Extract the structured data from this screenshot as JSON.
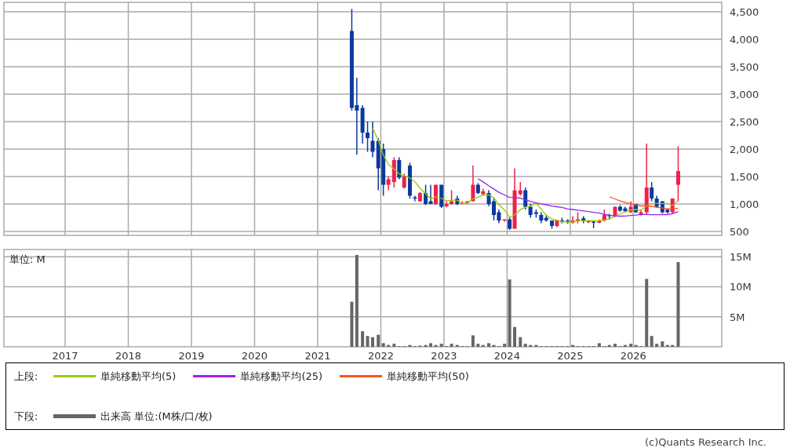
{
  "price_chart": {
    "chart_data": {
      "type": "candlestick",
      "grid": true,
      "xlim": [
        2016.03,
        2027.4
      ],
      "ylim": [
        429,
        4671
      ],
      "yticks": [
        {
          "value": 500,
          "label": "500"
        },
        {
          "value": 1000,
          "label": "1,000"
        },
        {
          "value": 1500,
          "label": "1,500"
        },
        {
          "value": 2000,
          "label": "2,000"
        },
        {
          "value": 2500,
          "label": "2,500"
        },
        {
          "value": 3000,
          "label": "3,000"
        },
        {
          "value": 3500,
          "label": "3,500"
        },
        {
          "value": 4000,
          "label": "4,000"
        },
        {
          "value": 4500,
          "label": "4,500"
        }
      ],
      "x": [
        2021.54,
        2021.62,
        2021.71,
        2021.79,
        2021.87,
        2021.96,
        2022.04,
        2022.12,
        2022.21,
        2022.29,
        2022.37,
        2022.46,
        2022.54,
        2022.62,
        2022.71,
        2022.79,
        2022.87,
        2022.96,
        2023.04,
        2023.12,
        2023.21,
        2023.29,
        2023.37,
        2023.46,
        2023.54,
        2023.62,
        2023.71,
        2023.79,
        2023.87,
        2023.96,
        2024.04,
        2024.12,
        2024.21,
        2024.29,
        2024.37,
        2024.46,
        2024.54,
        2024.62,
        2024.71,
        2024.79,
        2024.87,
        2024.96,
        2025.04,
        2025.12,
        2025.21,
        2025.29,
        2025.37,
        2025.46,
        2025.54,
        2025.62,
        2025.71,
        2025.79,
        2025.87,
        2025.96,
        2026.04,
        2026.12,
        2026.21,
        2026.29,
        2026.37,
        2026.46,
        2026.54,
        2026.62,
        2026.71
      ],
      "series": [
        {
          "name": "単純移動平均(5)",
          "type": "line",
          "color": "#99cc00",
          "values": [
            null,
            null,
            null,
            null,
            2380,
            2160,
            1890,
            1720,
            1640,
            1546,
            1516,
            1476,
            1406,
            1286,
            1190,
            1090,
            1130,
            1100,
            1060,
            1070,
            1070,
            1004,
            1024,
            1094,
            1124,
            1170,
            1166,
            1116,
            986,
            890,
            754,
            804,
            894,
            944,
            960,
            1014,
            904,
            794,
            724,
            704,
            676,
            672,
            672,
            696,
            696,
            698,
            694,
            694,
            710,
            726,
            778,
            822,
            856,
            886,
            900,
            880,
            964,
            1010,
            1010,
            1010,
            1010,
            970,
            1070
          ]
        },
        {
          "name": "単純移動平均(25)",
          "type": "line",
          "color": "#a020f0",
          "values": [
            null,
            null,
            null,
            null,
            null,
            null,
            null,
            null,
            null,
            null,
            null,
            null,
            null,
            null,
            null,
            null,
            null,
            null,
            null,
            null,
            null,
            null,
            null,
            null,
            1462,
            1401,
            1333,
            1273,
            1213,
            1164,
            1120,
            1116,
            1108,
            1074,
            1047,
            1020,
            1002,
            986,
            962,
            950,
            937,
            910,
            900,
            889,
            875,
            862,
            848,
            834,
            812,
            795,
            784,
            779,
            782,
            792,
            797,
            809,
            811,
            805,
            805,
            807,
            808,
            824,
            860
          ]
        },
        {
          "name": "単純移動平均(50)",
          "type": "line",
          "color": "#ff5020",
          "values": [
            null,
            null,
            null,
            null,
            null,
            null,
            null,
            null,
            null,
            null,
            null,
            null,
            null,
            null,
            null,
            null,
            null,
            null,
            null,
            null,
            null,
            null,
            null,
            null,
            null,
            null,
            null,
            null,
            null,
            null,
            null,
            null,
            null,
            null,
            null,
            null,
            null,
            null,
            null,
            null,
            null,
            null,
            null,
            null,
            null,
            null,
            null,
            null,
            null,
            1129,
            1093,
            1056,
            1028,
            1003,
            981,
            965,
            964,
            957,
            940,
            927,
            914,
            913,
            923
          ]
        }
      ],
      "ohlc": [
        [
          4150,
          4550,
          2700,
          2750
        ],
        [
          2800,
          3300,
          1900,
          2700
        ],
        [
          2750,
          2800,
          2100,
          2300
        ],
        [
          2300,
          2500,
          1950,
          2200
        ],
        [
          2150,
          2500,
          1850,
          1950
        ],
        [
          2150,
          2200,
          1250,
          1650
        ],
        [
          2000,
          2100,
          1150,
          1350
        ],
        [
          1350,
          1500,
          1250,
          1450
        ],
        [
          1400,
          1850,
          1300,
          1800
        ],
        [
          1800,
          1850,
          1450,
          1480
        ],
        [
          1300,
          1550,
          1280,
          1500
        ],
        [
          1700,
          1750,
          1100,
          1150
        ],
        [
          1120,
          1150,
          1050,
          1100
        ],
        [
          1050,
          1220,
          1040,
          1200
        ],
        [
          1200,
          1350,
          980,
          1000
        ],
        [
          1050,
          1350,
          1000,
          1000
        ],
        [
          1000,
          1350,
          980,
          1350
        ],
        [
          1350,
          1350,
          930,
          950
        ],
        [
          960,
          1050,
          940,
          1000
        ],
        [
          1000,
          1250,
          990,
          1050
        ],
        [
          1100,
          1150,
          980,
          1000
        ],
        [
          1000,
          1050,
          990,
          1020
        ],
        [
          1020,
          1050,
          1000,
          1050
        ],
        [
          1050,
          1700,
          1050,
          1350
        ],
        [
          1350,
          1380,
          1180,
          1200
        ],
        [
          1180,
          1280,
          1150,
          1230
        ],
        [
          1200,
          1250,
          960,
          1000
        ],
        [
          1050,
          1100,
          700,
          800
        ],
        [
          850,
          900,
          650,
          700
        ],
        [
          700,
          720,
          680,
          720
        ],
        [
          720,
          760,
          530,
          550
        ],
        [
          550,
          1650,
          550,
          1250
        ],
        [
          1180,
          1400,
          1150,
          1250
        ],
        [
          1250,
          1300,
          900,
          950
        ],
        [
          950,
          1000,
          750,
          800
        ],
        [
          850,
          900,
          750,
          820
        ],
        [
          800,
          850,
          650,
          700
        ],
        [
          750,
          800,
          680,
          700
        ],
        [
          700,
          700,
          550,
          600
        ],
        [
          600,
          700,
          580,
          700
        ],
        [
          700,
          750,
          650,
          680
        ],
        [
          700,
          720,
          640,
          680
        ],
        [
          660,
          780,
          640,
          700
        ],
        [
          700,
          850,
          650,
          720
        ],
        [
          740,
          780,
          650,
          700
        ],
        [
          680,
          700,
          650,
          690
        ],
        [
          680,
          700,
          560,
          660
        ],
        [
          660,
          720,
          650,
          700
        ],
        [
          700,
          900,
          680,
          800
        ],
        [
          800,
          820,
          720,
          780
        ],
        [
          780,
          950,
          760,
          950
        ],
        [
          950,
          980,
          860,
          880
        ],
        [
          920,
          950,
          860,
          870
        ],
        [
          850,
          1050,
          840,
          950
        ],
        [
          1000,
          1000,
          840,
          850
        ],
        [
          800,
          900,
          790,
          850
        ],
        [
          850,
          2100,
          800,
          1300
        ],
        [
          1300,
          1400,
          1050,
          1100
        ],
        [
          1100,
          1150,
          930,
          950
        ],
        [
          1050,
          1050,
          830,
          850
        ],
        [
          900,
          900,
          830,
          850
        ],
        [
          850,
          1100,
          820,
          1100
        ],
        [
          1350,
          2050,
          1050,
          1600
        ]
      ]
    }
  },
  "volume_chart": {
    "unit_label": "単位: M",
    "chart_data": {
      "type": "bar",
      "grid": true,
      "xlim": [
        2016.03,
        2027.4
      ],
      "ylim": [
        0,
        16.2
      ],
      "xticks": [
        {
          "value": 2017,
          "label": "2017"
        },
        {
          "value": 2018,
          "label": "2018"
        },
        {
          "value": 2019,
          "label": "2019"
        },
        {
          "value": 2020,
          "label": "2020"
        },
        {
          "value": 2021,
          "label": "2021"
        },
        {
          "value": 2022,
          "label": "2022"
        },
        {
          "value": 2023,
          "label": "2023"
        },
        {
          "value": 2024,
          "label": "2024"
        },
        {
          "value": 2025,
          "label": "2025"
        },
        {
          "value": 2026,
          "label": "2026"
        }
      ],
      "yticks": [
        {
          "value": 5,
          "label": "5M"
        },
        {
          "value": 10,
          "label": "10M"
        },
        {
          "value": 15,
          "label": "15M"
        }
      ],
      "x": [
        2021.54,
        2021.62,
        2021.71,
        2021.79,
        2021.87,
        2021.96,
        2022.04,
        2022.12,
        2022.21,
        2022.29,
        2022.37,
        2022.46,
        2022.54,
        2022.62,
        2022.71,
        2022.79,
        2022.87,
        2022.96,
        2023.04,
        2023.12,
        2023.21,
        2023.29,
        2023.37,
        2023.46,
        2023.54,
        2023.62,
        2023.71,
        2023.79,
        2023.87,
        2023.96,
        2024.04,
        2024.12,
        2024.21,
        2024.29,
        2024.37,
        2024.46,
        2024.54,
        2024.62,
        2024.71,
        2024.79,
        2024.87,
        2024.96,
        2025.04,
        2025.12,
        2025.21,
        2025.29,
        2025.37,
        2025.46,
        2025.54,
        2025.62,
        2025.71,
        2025.79,
        2025.87,
        2025.96,
        2026.04,
        2026.12,
        2026.21,
        2026.29,
        2026.37,
        2026.46,
        2026.54,
        2026.62,
        2026.71
      ],
      "series": [
        {
          "name": "出来高 単位:(M株/口/枚)",
          "color": "#666666",
          "values": [
            7.5,
            15.3,
            2.6,
            1.8,
            1.6,
            2.0,
            0.6,
            0.3,
            0.5,
            0.1,
            0.1,
            0.3,
            0.1,
            0.2,
            0.3,
            0.6,
            0.3,
            0.5,
            0.1,
            0.5,
            0.3,
            0.1,
            0.1,
            1.9,
            0.5,
            0.3,
            0.6,
            0.3,
            0.1,
            0.5,
            11.2,
            3.3,
            1.6,
            0.5,
            0.3,
            0.3,
            0.1,
            0.1,
            0.1,
            0.1,
            0.1,
            0.1,
            0.3,
            0.1,
            0.1,
            0.1,
            0.1,
            0.6,
            0.1,
            0.3,
            0.5,
            0.1,
            0.3,
            0.5,
            0.3,
            0.1,
            11.3,
            1.8,
            0.5,
            0.9,
            0.3,
            0.3,
            14.1
          ]
        }
      ]
    }
  },
  "legend": {
    "upper_label": "上段:",
    "lower_label": "下段:"
  },
  "credit": "(c)Quants Research Inc."
}
